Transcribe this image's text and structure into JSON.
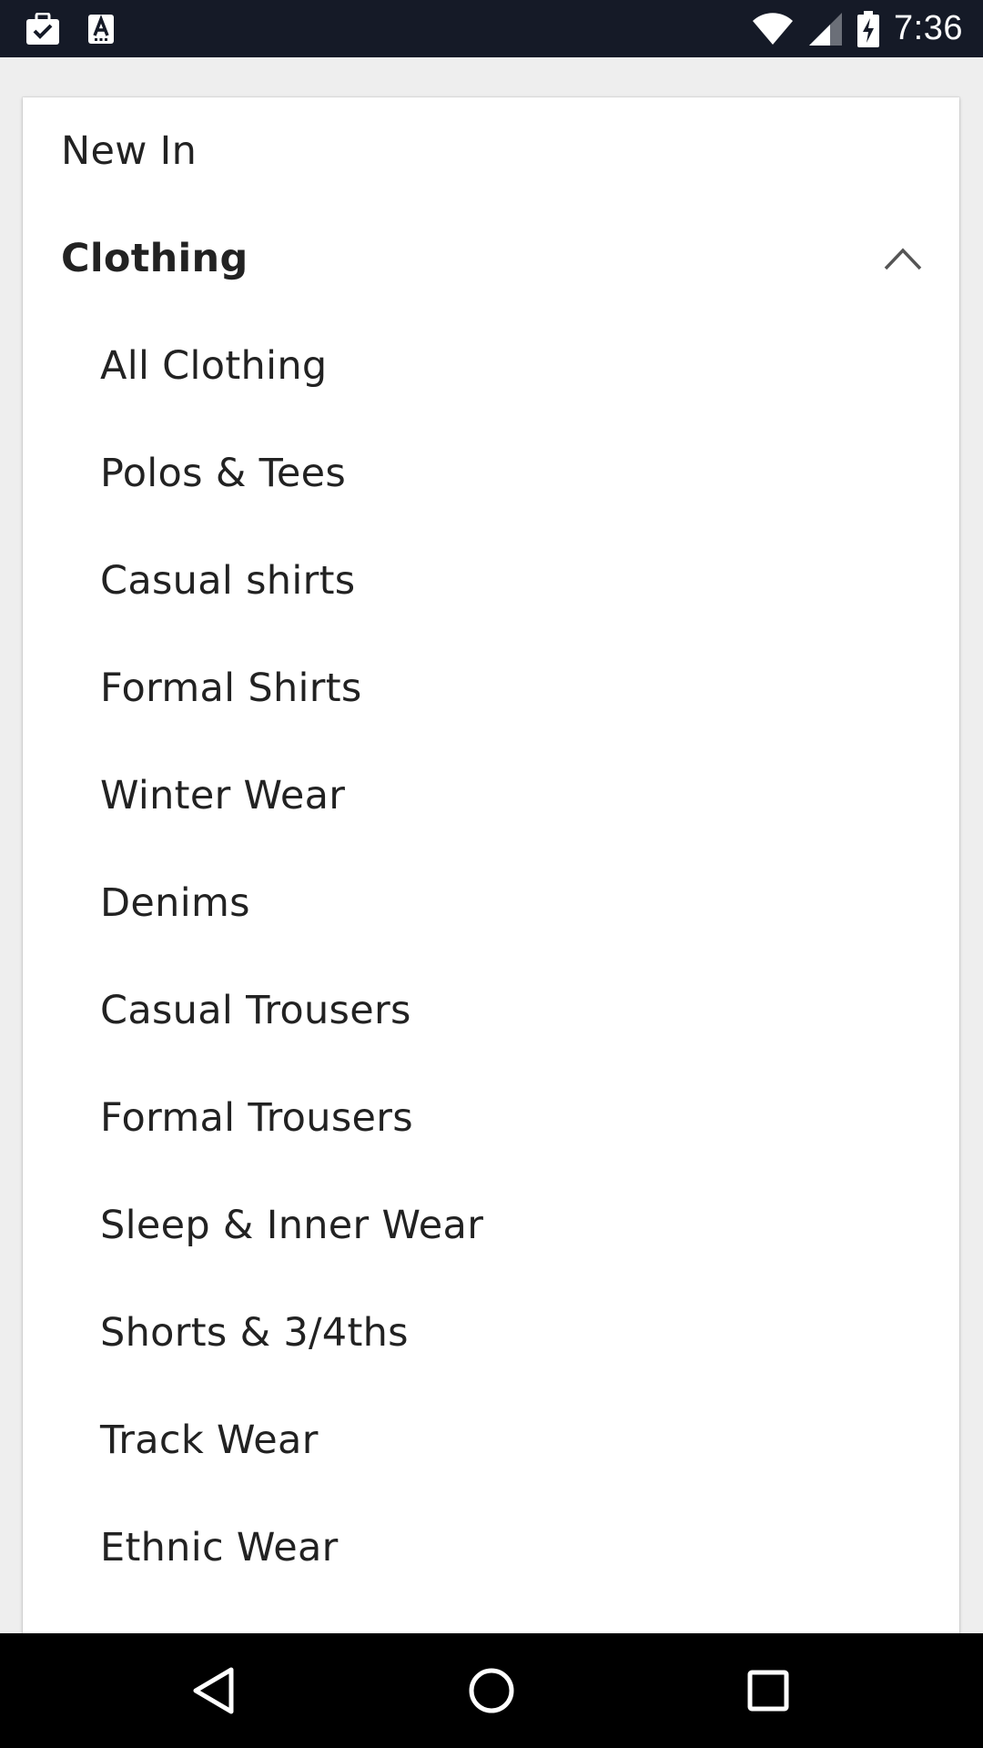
{
  "status_bar": {
    "time": "7:36",
    "left_icons": [
      "briefcase-check-icon",
      "text-a-icon"
    ],
    "right_icons": [
      "wifi-icon",
      "signal-icon",
      "battery-charging-icon"
    ]
  },
  "menu": {
    "items": [
      {
        "label": "New In",
        "level": "top"
      },
      {
        "label": "Clothing",
        "level": "top",
        "expanded": true,
        "icon": "chevron-up-icon"
      }
    ],
    "subitems": [
      {
        "label": "All Clothing"
      },
      {
        "label": "Polos & Tees"
      },
      {
        "label": "Casual shirts"
      },
      {
        "label": "Formal Shirts"
      },
      {
        "label": "Winter Wear"
      },
      {
        "label": "Denims"
      },
      {
        "label": "Casual Trousers"
      },
      {
        "label": "Formal Trousers"
      },
      {
        "label": "Sleep & Inner Wear"
      },
      {
        "label": "Shorts & 3/4ths"
      },
      {
        "label": "Track Wear"
      },
      {
        "label": "Ethnic Wear"
      }
    ]
  },
  "nav_bar": {
    "buttons": [
      "back-icon",
      "home-icon",
      "recents-icon"
    ]
  },
  "colors": {
    "status_bar_bg": "#151a27",
    "page_bg": "#eeeeee",
    "card_bg": "#ffffff",
    "text": "#222222",
    "nav_bar_bg": "#000000"
  }
}
